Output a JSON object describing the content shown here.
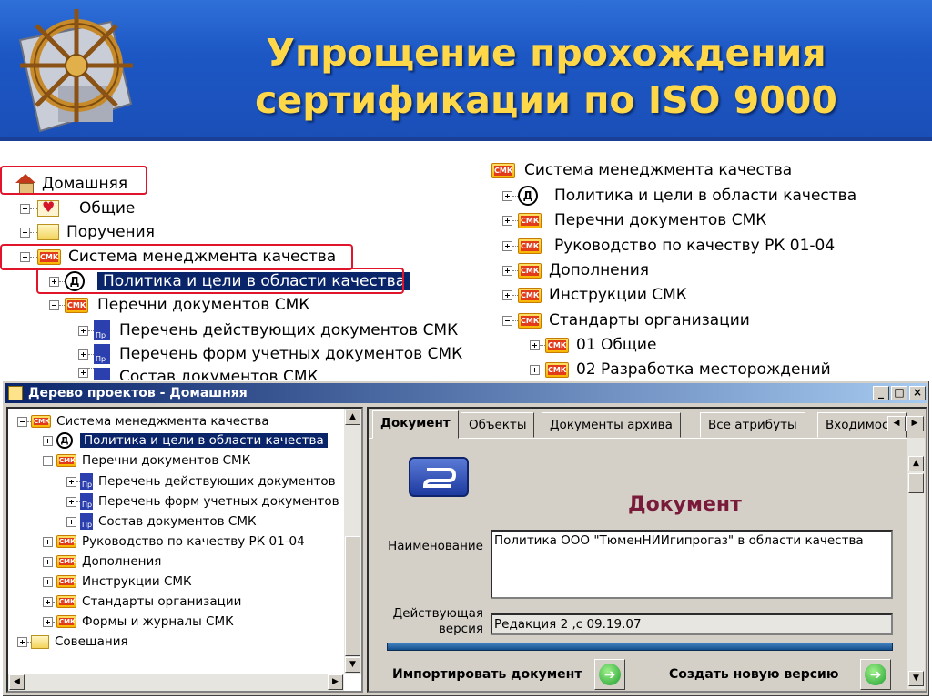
{
  "banner": {
    "title_line1": "Упрощение прохождения",
    "title_line2": "сертификации по ISO 9000"
  },
  "tree_left": {
    "items": [
      {
        "label": "Домашняя"
      },
      {
        "label": "Общие"
      },
      {
        "label": "Поручения"
      },
      {
        "label": "Система менеджмента качества"
      },
      {
        "label": "Политика и цели в области качества"
      },
      {
        "label": "Перечни документов СМК"
      },
      {
        "label": "Перечень действующих документов СМК"
      },
      {
        "label": "Перечень форм учетных документов СМК"
      },
      {
        "label": "Состав документов СМК"
      }
    ]
  },
  "tree_right": {
    "items": [
      {
        "label": "Система менеджмента качества"
      },
      {
        "label": "Политика и цели в области качества"
      },
      {
        "label": "Перечни документов СМК"
      },
      {
        "label": "Руководство по качеству РК 01-04"
      },
      {
        "label": "Дополнения"
      },
      {
        "label": "Инструкции СМК"
      },
      {
        "label": "Стандарты организации"
      },
      {
        "label": "01 Общие"
      },
      {
        "label": "02 Разработка месторождений"
      }
    ]
  },
  "icons": {
    "smk": "СМК",
    "d": "Д"
  },
  "window": {
    "title": "Дерево проектов - Домашняя",
    "tree": [
      {
        "label": "Система менеджмента качества"
      },
      {
        "label": "Политика и цели в области качества"
      },
      {
        "label": "Перечни документов СМК"
      },
      {
        "label": "Перечень действующих документов"
      },
      {
        "label": "Перечень форм учетных документов"
      },
      {
        "label": "Состав документов СМК"
      },
      {
        "label": "Руководство по качеству РК 01-04"
      },
      {
        "label": "Дополнения"
      },
      {
        "label": "Инструкции СМК"
      },
      {
        "label": "Стандарты организации"
      },
      {
        "label": "Формы и журналы СМК"
      },
      {
        "label": "Совещания"
      }
    ],
    "tabs": [
      "Документ",
      "Объекты",
      "Документы архива",
      "Все атрибуты",
      "Входимость"
    ],
    "doc_heading": "Документ",
    "name_label": "Наименование",
    "name_value": "Политика ООО \"ТюменНИИгипрогаз\" в области качества",
    "version_label_1": "Действующая",
    "version_label_2": "версия",
    "version_value": "Редакция 2 ,с  09.19.07",
    "import_label": "Импортировать документ",
    "new_version_label": "Создать новую версию"
  },
  "colors": {
    "banner_bg": "#1c57c4",
    "title_color": "#ffd84a",
    "highlight_red": "#e0142b",
    "selection_bg": "#0a246a",
    "doc_heading_color": "#7a1a3a"
  }
}
